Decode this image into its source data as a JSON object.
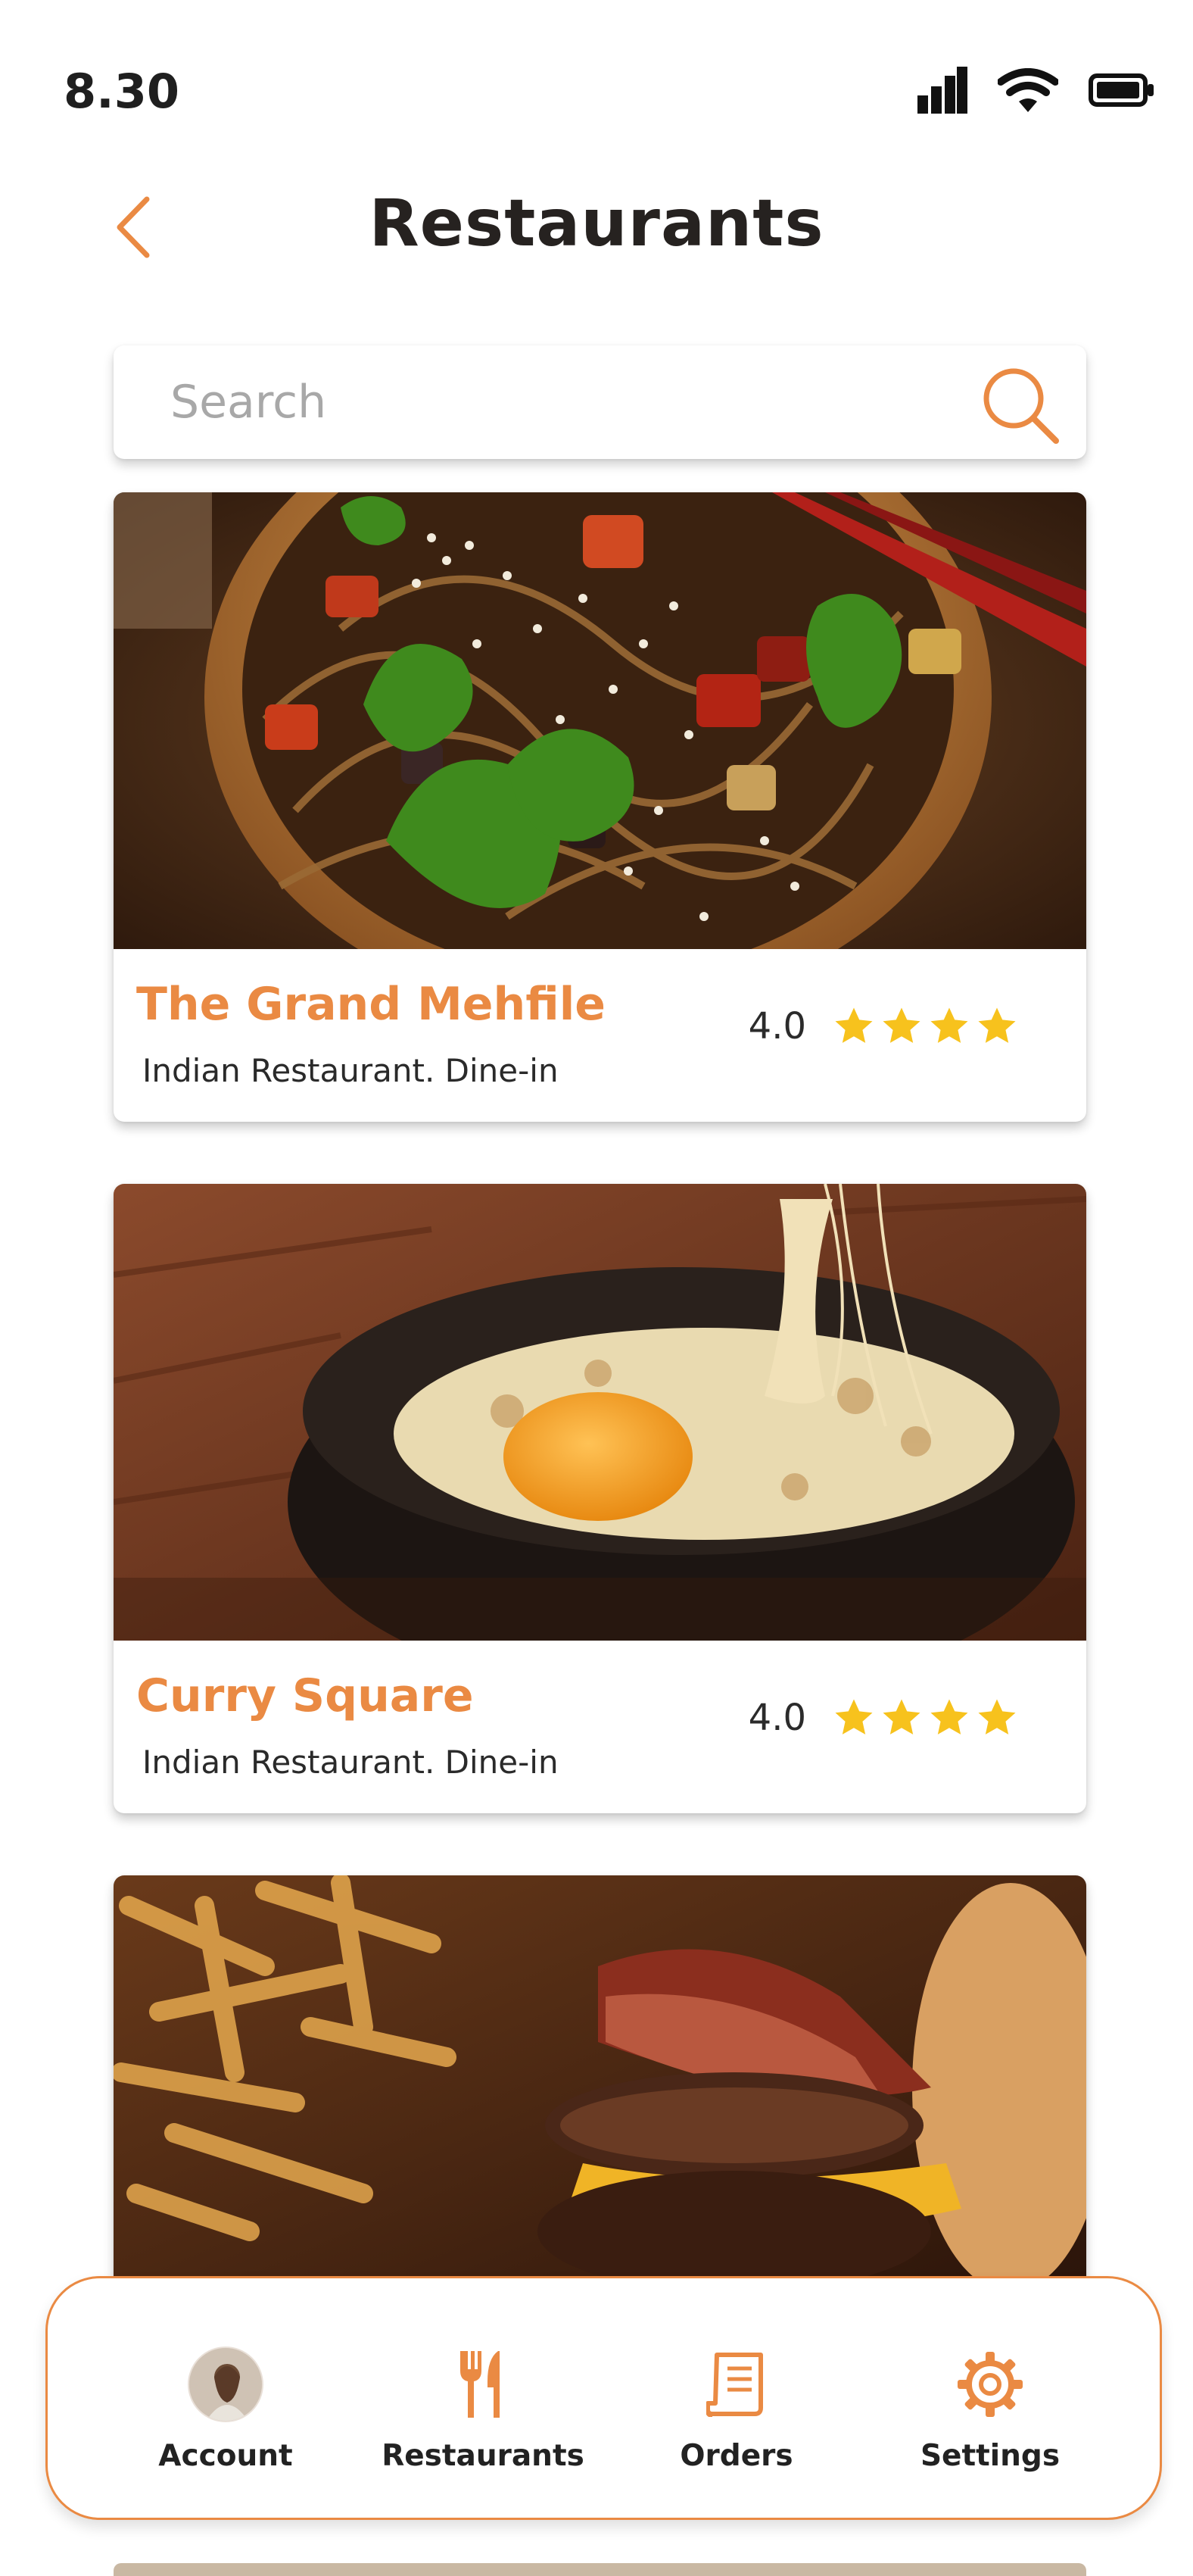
{
  "status_bar": {
    "time": "8.30"
  },
  "header": {
    "title": "Restaurants"
  },
  "search": {
    "placeholder": "Search"
  },
  "restaurants": [
    {
      "name": "The Grand Mehfile",
      "subtitle": "Indian Restaurant. Dine-in",
      "rating": "4.0",
      "stars": 4
    },
    {
      "name": "Curry Square",
      "subtitle": "Indian Restaurant. Dine-in",
      "rating": "4.0",
      "stars": 4
    }
  ],
  "bottom_nav": {
    "items": [
      {
        "label": "Account",
        "icon": "avatar"
      },
      {
        "label": "Restaurants",
        "icon": "fork-knife-icon"
      },
      {
        "label": "Orders",
        "icon": "receipt-icon"
      },
      {
        "label": "Settings",
        "icon": "gear-icon"
      }
    ]
  },
  "colors": {
    "accent": "#ea8a43",
    "star": "#f7c21d",
    "text": "#262220"
  }
}
